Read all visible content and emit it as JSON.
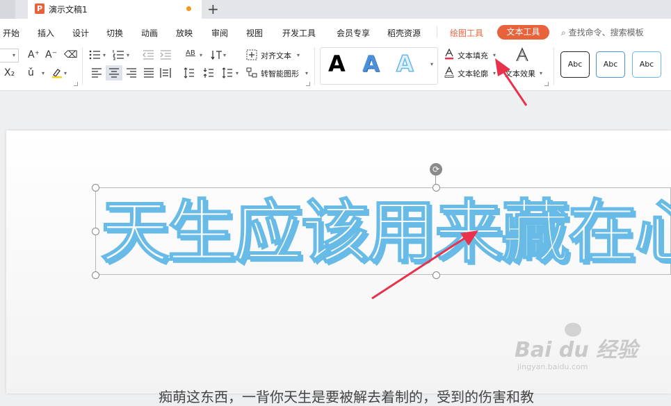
{
  "titlebar": {
    "tab_badge": "P",
    "doc_title": "演示文稿1",
    "new_tab": "+"
  },
  "menu": {
    "items": [
      "开始",
      "插入",
      "设计",
      "切换",
      "动画",
      "放映",
      "审阅",
      "视图",
      "开发工具",
      "会员专享",
      "稻壳资源"
    ],
    "draw_tools": "绘图工具",
    "text_tools": "文本工具",
    "search": "查找命令、搜索模板"
  },
  "ribbon": {
    "font_grow": "A⁺",
    "font_shrink": "A⁻",
    "clear": "⌫",
    "subscript": "X₂",
    "phonetic": "ǔ",
    "align_text": "对齐文本",
    "smart_art": "转智能图形",
    "styles": [
      "A",
      "A",
      "A"
    ],
    "text_fill": "文本填充",
    "text_outline": "文本轮廓",
    "text_effect": "文本效果",
    "shape_styles": [
      "Abc",
      "Abc",
      "Abc"
    ]
  },
  "slide": {
    "art_text": "天生应该用来藏在心",
    "body_text": "痴萌这东西，一背你天生是要被解去着制的，受到的伤害和教"
  },
  "watermark": {
    "brand": "Bai du 经验",
    "url": "jingyan.baidu.com"
  },
  "colors": {
    "accent": "#e8633b",
    "art_outline": "#67bbe6",
    "arrow": "#e8314a"
  }
}
